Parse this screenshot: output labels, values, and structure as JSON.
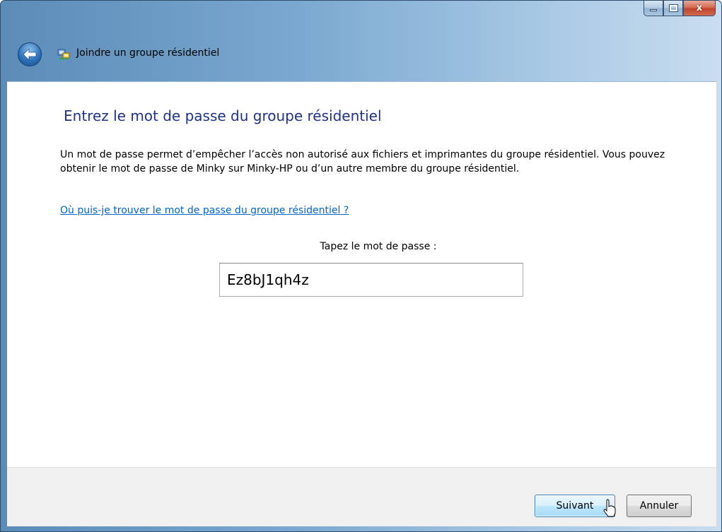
{
  "window": {
    "title": "Joindre un groupe résidentiel",
    "caption_buttons": {
      "close_glyph": "x"
    }
  },
  "content": {
    "heading": "Entrez le mot de passe du groupe résidentiel",
    "paragraph": "Un mot de passe permet d’empêcher l’accès non autorisé aux fichiers et imprimantes du groupe résidentiel. Vous pouvez obtenir le mot de passe de Minky sur Minky-HP ou d’un autre membre du groupe résidentiel.",
    "help_link": "Où puis-je trouver le mot de passe du groupe résidentiel ?",
    "password_label": "Tapez le mot de passe :",
    "password_value": "Ez8bJ1qh4z"
  },
  "footer": {
    "next_label": "Suivant",
    "cancel_label": "Annuler"
  },
  "icons": {
    "back": "back-arrow-icon",
    "homegroup": "homegroup-network-icon",
    "cursor": "mouse-pointer-icon"
  },
  "colors": {
    "heading": "#1e3287",
    "link": "#0066cc",
    "footer_bg": "#f0f0f0",
    "frame": "#79a7cf"
  }
}
